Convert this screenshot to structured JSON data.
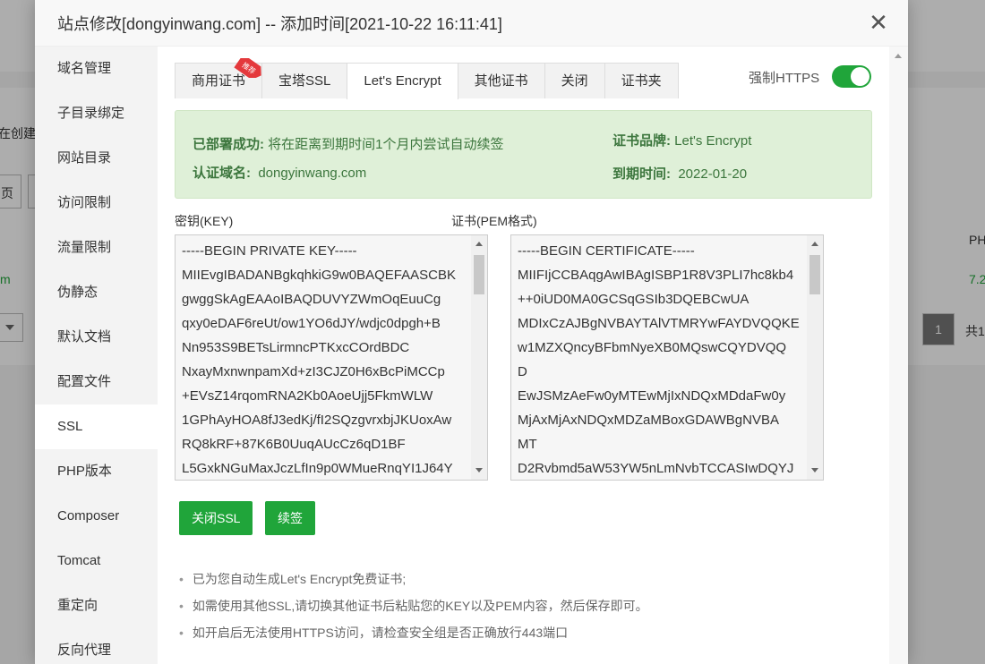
{
  "background": {
    "left_fragment": "在创建站",
    "page_fragment": "页",
    "green_fragment": "m",
    "right_header": "PH",
    "right_value": "7.2",
    "pager_current": "1",
    "pager_total": "共1"
  },
  "modal": {
    "title": "站点修改[dongyinwang.com] -- 添加时间[2021-10-22 16:11:41]",
    "close_symbol": "✕"
  },
  "sidebar": {
    "items": [
      {
        "label": "域名管理"
      },
      {
        "label": "子目录绑定"
      },
      {
        "label": "网站目录"
      },
      {
        "label": "访问限制"
      },
      {
        "label": "流量限制"
      },
      {
        "label": "伪静态"
      },
      {
        "label": "默认文档"
      },
      {
        "label": "配置文件"
      },
      {
        "label": "SSL"
      },
      {
        "label": "PHP版本"
      },
      {
        "label": "Composer"
      },
      {
        "label": "Tomcat"
      },
      {
        "label": "重定向"
      },
      {
        "label": "反向代理"
      }
    ],
    "active": "SSL"
  },
  "tabs": {
    "items": [
      {
        "label": "商用证书"
      },
      {
        "label": "宝塔SSL"
      },
      {
        "label": "Let's Encrypt"
      },
      {
        "label": "其他证书"
      },
      {
        "label": "关闭"
      },
      {
        "label": "证书夹"
      }
    ],
    "active": "Let's Encrypt",
    "recommend_tag": "推荐"
  },
  "force_https": {
    "label": "强制HTTPS",
    "enabled": true
  },
  "status": {
    "deployed_label": "已部署成功:",
    "deployed_text": "将在距离到期时间1个月内尝试自动续签",
    "domain_label": "认证域名:",
    "domain_value": "dongyinwang.com",
    "brand_label": "证书品牌:",
    "brand_value": "Let's Encrypt",
    "expire_label": "到期时间:",
    "expire_value": "2022-01-20"
  },
  "key_field": {
    "label": "密钥(KEY)",
    "lines": [
      "-----BEGIN PRIVATE KEY-----",
      "MIIEvgIBADANBgkqhkiG9w0BAQEFAASCBK",
      "gwggSkAgEAAoIBAQDUVYZWmOqEuuCg",
      "qxy0eDAF6reUt/ow1YO6dJY/wdjc0dpgh+B",
      "Nn953S9BETsLirmncPTKxcCOrdBDC",
      "NxayMxnwnpamXd+zI3CJZ0H6xBcPiMCCp",
      "+EVsZ14rqomRNA2Kb0AoeUjj5FkmWLW",
      "1GPhAyHOA8fJ3edKj/fI2SQzgvrxbjJKUoxAw",
      "RQ8kRF+87K6B0UuqAUcCz6qD1BF",
      "L5GxkNGuMaxJczLfIn9p0WMueRnqYI1J64Y"
    ]
  },
  "cert_field": {
    "label": "证书(PEM格式)",
    "lines": [
      "-----BEGIN CERTIFICATE-----",
      "MIIFIjCCBAqgAwIBAgISBP1R8V3PLI7hc8kb4",
      "++0iUD0MA0GCSqGSIb3DQEBCwUA",
      "MDIxCzAJBgNVBAYTAlVTMRYwFAYDVQQKE",
      "w1MZXQncyBFbmNyeXB0MQswCQYDVQQ",
      "D",
      "EwJSMzAeFw0yMTEwMjIxNDQxMDdaFw0y",
      "MjAxMjAxNDQxMDZaMBoxGDAWBgNVBA",
      "MT",
      "D2Rvbmd5aW53YW5nLmNvbTCCASIwDQYJ"
    ]
  },
  "buttons": {
    "close_ssl": "关闭SSL",
    "renew": "续签"
  },
  "tips": [
    "已为您自动生成Let's Encrypt免费证书;",
    "如需使用其他SSL,请切换其他证书后粘贴您的KEY以及PEM内容，然后保存即可。",
    "如开启后无法使用HTTPS访问，请检查安全组是否正确放行443端口"
  ],
  "colors": {
    "accent": "#20a53a",
    "status_bg": "#dff0d8",
    "status_text": "#3c763d"
  }
}
